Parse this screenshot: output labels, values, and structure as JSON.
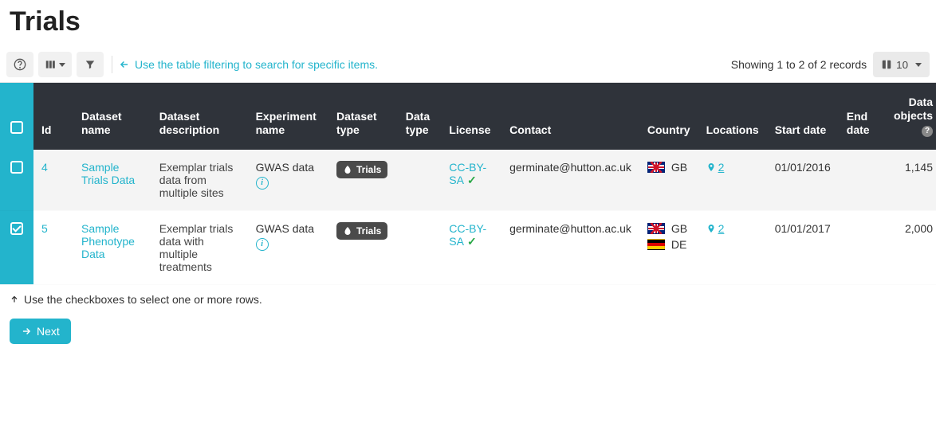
{
  "page": {
    "title": "Trials"
  },
  "toolbar": {
    "hint": "Use the table filtering to search for specific items.",
    "showing": "Showing 1 to 2 of 2 records",
    "page_size": "10"
  },
  "columns": {
    "id": "Id",
    "name": "Dataset name",
    "desc": "Dataset description",
    "exp": "Experiment name",
    "dtype": "Dataset type",
    "datatype": "Data type",
    "license": "License",
    "contact": "Contact",
    "country": "Country",
    "locations": "Locations",
    "start": "Start date",
    "end": "End date",
    "objects": "Data objects"
  },
  "badge": {
    "trials": "Trials"
  },
  "rows": [
    {
      "selected": false,
      "id": "4",
      "name": "Sample Trials Data",
      "desc": "Exemplar trials data from multiple sites",
      "exp": "GWAS data",
      "license": "CC-BY-SA",
      "contact": "germinate@hutton.ac.uk",
      "countries": [
        {
          "code": "GB",
          "flag": "gb"
        }
      ],
      "locations": "2",
      "start": "01/01/2016",
      "end": "",
      "objects": "1,145"
    },
    {
      "selected": true,
      "id": "5",
      "name": "Sample Phenotype Data",
      "desc": "Exemplar trials data with multiple treatments",
      "exp": "GWAS data",
      "license": "CC-BY-SA",
      "contact": "germinate@hutton.ac.uk",
      "countries": [
        {
          "code": "GB",
          "flag": "gb"
        },
        {
          "code": "DE",
          "flag": "de"
        }
      ],
      "locations": "2",
      "start": "01/01/2017",
      "end": "",
      "objects": "2,000"
    }
  ],
  "footer": {
    "hint": "Use the checkboxes to select one or more rows.",
    "next": "Next"
  }
}
